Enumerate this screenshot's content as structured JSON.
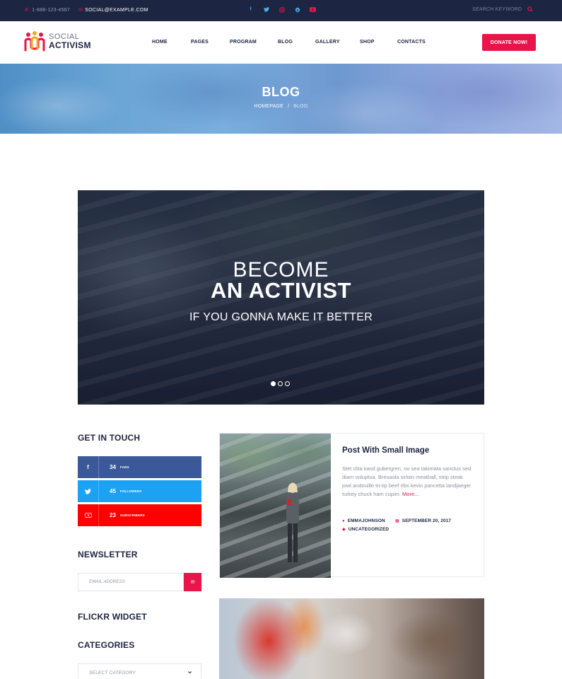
{
  "topbar": {
    "phone": "1-888-123-4567",
    "email": "SOCIAL@EXAMPLE.COM",
    "search_placeholder": "SEARCH KEYWORD"
  },
  "logo": {
    "line1": "SOCIAL",
    "line2": "ACTIVISM"
  },
  "nav": {
    "items": [
      "HOME",
      "PAGES",
      "PROGRAM",
      "BLOG",
      "GALLERY",
      "SHOP",
      "CONTACTS"
    ],
    "donate_label": "DONATE NOW!"
  },
  "banner": {
    "title": "BLOG",
    "breadcrumb": [
      "HOMEPAGE",
      "/",
      "BLOG"
    ]
  },
  "slider": {
    "line1": "BECOME",
    "line2": "AN ACTIVIST",
    "line3": "IF YOU GONNA MAKE IT BETTER",
    "slide_count": 3,
    "active_slide": 1
  },
  "sidebar": {
    "get_in_touch_title": "GET IN TOUCH",
    "socials": [
      {
        "icon": "facebook-icon",
        "count": "34",
        "label": "FANS",
        "color": "#3b5998"
      },
      {
        "icon": "twitter-icon",
        "count": "45",
        "label": "FOLLOWERS",
        "color": "#1da1f2"
      },
      {
        "icon": "youtube-icon",
        "count": "23",
        "label": "SUBSCRIBERS",
        "color": "#ff0000"
      }
    ],
    "newsletter_title": "NEWSLETTER",
    "newsletter_placeholder": "EMAIL ADDRESS",
    "flickr_title": "FLICKR WIDGET",
    "categories_title": "CATEGORIES",
    "category_select": "SELECT CATEGORY"
  },
  "posts": [
    {
      "title": "Post With Small Image",
      "excerpt": "Stet clita kasd gubergren, no sea takimata sanctus sed diam voluptua. Bresaola sirloin meatball, strip steak jowl andouille tri-tip beef ribs kevin pancetta landjaeger turkey chuck ham cupim. ",
      "more": "More...",
      "author": "EMMAJOHNSON",
      "date": "SEPTEMBER 20, 2017",
      "category": "UNCATEGORIZED"
    }
  ],
  "colors": {
    "accent": "#e8154b",
    "dark": "#1c2541"
  }
}
